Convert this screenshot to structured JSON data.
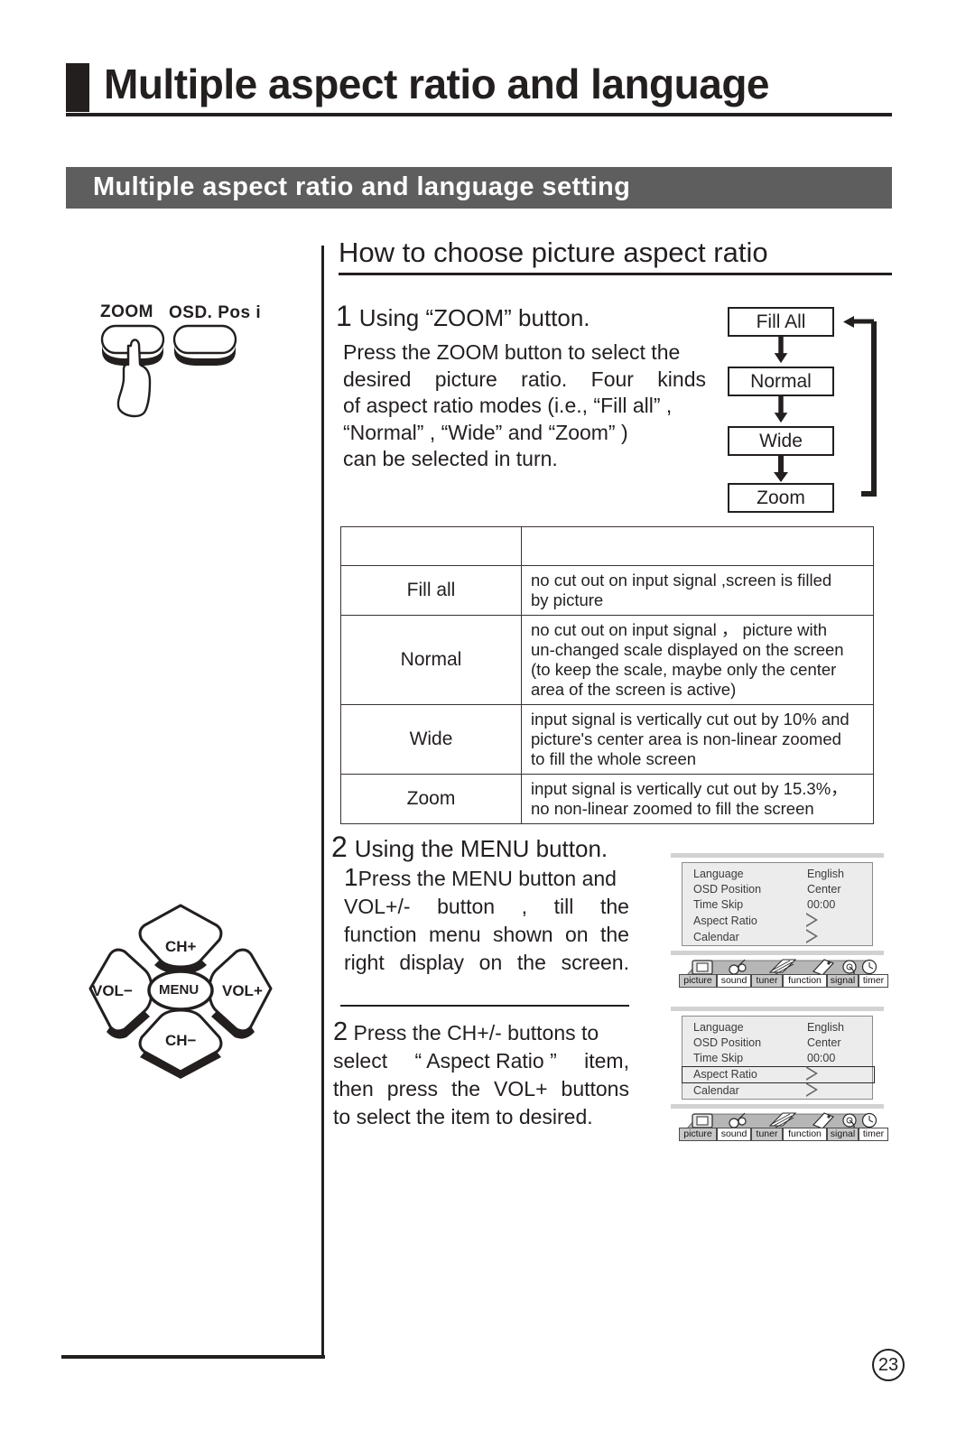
{
  "page": {
    "title": "Multiple aspect ratio and language",
    "section_banner": "Multiple aspect ratio and language setting",
    "page_number": "23"
  },
  "howto": {
    "heading": "How to choose picture aspect ratio"
  },
  "step1": {
    "number": "1",
    "title": "Using  “ZOOM”  button.",
    "body_lines": [
      "Press the ZOOM button to select the",
      "desired   picture   ratio.   Four   kinds",
      "of aspect ratio modes (i.e.,  “Fill all” ,",
      " “Normal” , “Wide” and “Zoom” )",
      "can be selected in turn."
    ],
    "body_line2_words": [
      "desired",
      "picture",
      "ratio.",
      "Four",
      "kinds"
    ]
  },
  "aspect_flow": {
    "boxes": [
      "Fill All",
      "Normal",
      "Wide",
      "Zoom"
    ]
  },
  "mode_table": {
    "header": [
      "",
      ""
    ],
    "rows": [
      {
        "mode": "Fill all",
        "desc_lines": [
          " no cut out on input signal ,screen is filled",
          " by picture"
        ]
      },
      {
        "mode": "Normal",
        "desc_lines": [
          "no cut out on input signal ，  picture with",
          "un-changed scale displayed on the screen",
          "(to keep the scale, maybe only the center",
          "area of the screen is active)"
        ]
      },
      {
        "mode": "Wide",
        "desc_lines": [
          "input signal is vertically cut out by 10% and",
          "picture's center area is non-linear zoomed",
          "to fill the whole screen"
        ]
      },
      {
        "mode": "Zoom",
        "desc_lines": [
          "input signal is vertically cut out by 15.3%，",
          "no non-linear zoomed  to fill the screen"
        ]
      }
    ]
  },
  "step2": {
    "number": "2",
    "title": "Using  the MENU button.",
    "sub1": {
      "number": "1",
      "lines": [
        "Press the MENU button and",
        "VOL+/-  button  ,  till  the",
        "function  menu shown on the",
        "right  display  on  the  screen."
      ],
      "line2_words": [
        "VOL+/-",
        "button",
        ",",
        "till",
        "the"
      ],
      "line3_words": [
        "function",
        "menu",
        "shown",
        "on",
        "the"
      ],
      "line4_words": [
        "right",
        "display",
        "on",
        "the",
        "screen."
      ]
    },
    "sub2": {
      "number": "2",
      "lines": [
        "Press the CH+/- buttons to",
        "select “ Aspect Ratio ” item,",
        "then press the VOL+ buttons",
        "to select the item to desired."
      ],
      "line2_words": [
        "select",
        "“ Aspect Ratio ”",
        "item,"
      ],
      "line3_words": [
        "then",
        "press",
        "the",
        "VOL+",
        "buttons"
      ]
    }
  },
  "zoom_button_figure": {
    "zoom_label": "ZOOM",
    "osd_posi_label": "OSD. Pos i"
  },
  "dpad_figure": {
    "ch_up": "CH+",
    "ch_down": "CH−",
    "vol_minus": "VOL−",
    "vol_plus": "VOL+",
    "menu": "MENU"
  },
  "osd_menus": [
    {
      "id": "osd-1",
      "rows": [
        {
          "label": "Language",
          "value": "English",
          "type": "text",
          "highlighted": false
        },
        {
          "label": "OSD Position",
          "value": "Center",
          "type": "text",
          "highlighted": false
        },
        {
          "label": "Time Skip",
          "value": "00:00",
          "type": "text",
          "highlighted": false
        },
        {
          "label": "Aspect Ratio",
          "value": "",
          "type": "arrow",
          "highlighted": false
        },
        {
          "label": "Calendar",
          "value": "",
          "type": "arrow",
          "highlighted": false
        }
      ],
      "tabs": [
        {
          "label": "picture",
          "shaded": true
        },
        {
          "label": "sound",
          "shaded": false
        },
        {
          "label": "tuner",
          "shaded": true
        },
        {
          "label": "function",
          "shaded": false
        },
        {
          "label": "signal",
          "shaded": true
        },
        {
          "label": "timer",
          "shaded": false
        }
      ],
      "icons": [
        "picture-monitor-icon",
        "sound-note-icon",
        "tuner-wave-icon",
        "function-tag-icon",
        "signal-antenna-icon",
        "timer-clock-icon"
      ]
    },
    {
      "id": "osd-2",
      "rows": [
        {
          "label": "Language",
          "value": "English",
          "type": "text",
          "highlighted": false
        },
        {
          "label": "OSD Position",
          "value": "Center",
          "type": "text",
          "highlighted": false
        },
        {
          "label": "Time Skip",
          "value": "00:00",
          "type": "text",
          "highlighted": false
        },
        {
          "label": "Aspect Ratio",
          "value": "",
          "type": "arrow",
          "highlighted": true
        },
        {
          "label": "Calendar",
          "value": "",
          "type": "arrow",
          "highlighted": false
        }
      ],
      "tabs": [
        {
          "label": "picture",
          "shaded": true
        },
        {
          "label": "sound",
          "shaded": false
        },
        {
          "label": "tuner",
          "shaded": true
        },
        {
          "label": "function",
          "shaded": false
        },
        {
          "label": "signal",
          "shaded": true
        },
        {
          "label": "timer",
          "shaded": false
        }
      ],
      "icons": [
        "picture-monitor-icon",
        "sound-note-icon",
        "tuner-wave-icon",
        "function-tag-icon",
        "signal-antenna-icon",
        "timer-clock-icon"
      ]
    }
  ],
  "colors": {
    "ink": "#231f1f",
    "banner_gray": "#5e5e5e",
    "osd_panel": "#ececec",
    "osd_bar": "#d2d2d2"
  }
}
